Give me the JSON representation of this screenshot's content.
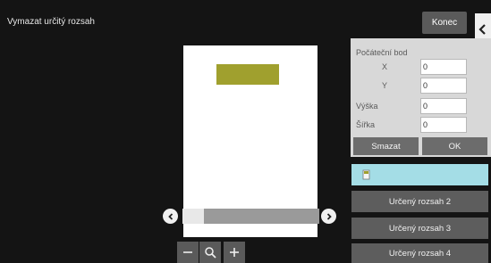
{
  "header": {
    "title": "Vymazat určitý rozsah",
    "done_label": "Konec"
  },
  "settings": {
    "section_label": "Počáteční bod",
    "x_label": "X",
    "x_value": "0",
    "y_label": "Y",
    "y_value": "0",
    "height_label": "Výška",
    "height_value": "0",
    "width_label": "Šířka",
    "width_value": "0",
    "clear_label": "Smazat",
    "ok_label": "OK"
  },
  "ranges": [
    {
      "label": ""
    },
    {
      "label": "Určený rozsah 2"
    },
    {
      "label": "Určený rozsah 3"
    },
    {
      "label": "Určený rozsah 4"
    }
  ],
  "colors": {
    "highlight": "#a0a02e",
    "selected_range": "#a4dde6"
  },
  "icons": [
    "chevron-left-icon",
    "chevron-right-icon",
    "minus-icon",
    "zoom-icon",
    "plus-icon",
    "document-icon"
  ]
}
